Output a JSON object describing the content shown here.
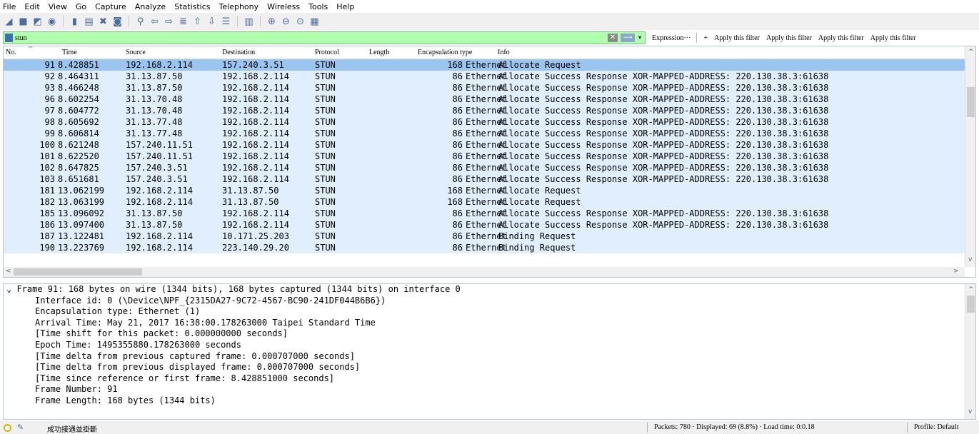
{
  "menu": [
    "File",
    "Edit",
    "View",
    "Go",
    "Capture",
    "Analyze",
    "Statistics",
    "Telephony",
    "Wireless",
    "Tools",
    "Help"
  ],
  "toolbar": {
    "icons": [
      "shark-fin-icon",
      "stop-icon",
      "restart-icon",
      "options-icon",
      "open-file-icon",
      "save-icon",
      "close-file-icon",
      "reload-icon",
      "find-icon",
      "back-icon",
      "forward-icon",
      "go-to-icon",
      "first-packet-icon",
      "last-packet-icon",
      "autoscroll-icon",
      "colorize-icon",
      "zoom-in-icon",
      "zoom-out-icon",
      "zoom-normal-icon",
      "resize-columns-icon"
    ]
  },
  "filter": {
    "value": "stun",
    "expression_label": "Expression···",
    "plus_label": "+",
    "apply_buttons": [
      "Apply this filter",
      "Apply this filter",
      "Apply this filter",
      "Apply this filter"
    ]
  },
  "columns": {
    "no": "No.",
    "time": "Time",
    "source": "Source",
    "destination": "Destination",
    "protocol": "Protocol",
    "length": "Length",
    "encapsulation": "Encapsulation type",
    "info": "Info"
  },
  "packets": [
    {
      "no": "91",
      "time": "8.428851",
      "src": "192.168.2.114",
      "dst": "157.240.3.51",
      "proto": "STUN",
      "len": "168",
      "enc": "Ethernet",
      "info": "Allocate Request"
    },
    {
      "no": "92",
      "time": "8.464311",
      "src": "31.13.87.50",
      "dst": "192.168.2.114",
      "proto": "STUN",
      "len": "86",
      "enc": "Ethernet",
      "info": "Allocate Success Response XOR-MAPPED-ADDRESS: 220.130.38.3:61638"
    },
    {
      "no": "93",
      "time": "8.466248",
      "src": "31.13.87.50",
      "dst": "192.168.2.114",
      "proto": "STUN",
      "len": "86",
      "enc": "Ethernet",
      "info": "Allocate Success Response XOR-MAPPED-ADDRESS: 220.130.38.3:61638"
    },
    {
      "no": "96",
      "time": "8.602254",
      "src": "31.13.70.48",
      "dst": "192.168.2.114",
      "proto": "STUN",
      "len": "86",
      "enc": "Ethernet",
      "info": "Allocate Success Response XOR-MAPPED-ADDRESS: 220.130.38.3:61638"
    },
    {
      "no": "97",
      "time": "8.604772",
      "src": "31.13.70.48",
      "dst": "192.168.2.114",
      "proto": "STUN",
      "len": "86",
      "enc": "Ethernet",
      "info": "Allocate Success Response XOR-MAPPED-ADDRESS: 220.130.38.3:61638"
    },
    {
      "no": "98",
      "time": "8.605692",
      "src": "31.13.77.48",
      "dst": "192.168.2.114",
      "proto": "STUN",
      "len": "86",
      "enc": "Ethernet",
      "info": "Allocate Success Response XOR-MAPPED-ADDRESS: 220.130.38.3:61638"
    },
    {
      "no": "99",
      "time": "8.606814",
      "src": "31.13.77.48",
      "dst": "192.168.2.114",
      "proto": "STUN",
      "len": "86",
      "enc": "Ethernet",
      "info": "Allocate Success Response XOR-MAPPED-ADDRESS: 220.130.38.3:61638"
    },
    {
      "no": "100",
      "time": "8.621248",
      "src": "157.240.11.51",
      "dst": "192.168.2.114",
      "proto": "STUN",
      "len": "86",
      "enc": "Ethernet",
      "info": "Allocate Success Response XOR-MAPPED-ADDRESS: 220.130.38.3:61638"
    },
    {
      "no": "101",
      "time": "8.622520",
      "src": "157.240.11.51",
      "dst": "192.168.2.114",
      "proto": "STUN",
      "len": "86",
      "enc": "Ethernet",
      "info": "Allocate Success Response XOR-MAPPED-ADDRESS: 220.130.38.3:61638"
    },
    {
      "no": "102",
      "time": "8.647825",
      "src": "157.240.3.51",
      "dst": "192.168.2.114",
      "proto": "STUN",
      "len": "86",
      "enc": "Ethernet",
      "info": "Allocate Success Response XOR-MAPPED-ADDRESS: 220.130.38.3:61638"
    },
    {
      "no": "103",
      "time": "8.651681",
      "src": "157.240.3.51",
      "dst": "192.168.2.114",
      "proto": "STUN",
      "len": "86",
      "enc": "Ethernet",
      "info": "Allocate Success Response XOR-MAPPED-ADDRESS: 220.130.38.3:61638"
    },
    {
      "no": "181",
      "time": "13.062199",
      "src": "192.168.2.114",
      "dst": "31.13.87.50",
      "proto": "STUN",
      "len": "168",
      "enc": "Ethernet",
      "info": "Allocate Request"
    },
    {
      "no": "182",
      "time": "13.063199",
      "src": "192.168.2.114",
      "dst": "31.13.87.50",
      "proto": "STUN",
      "len": "168",
      "enc": "Ethernet",
      "info": "Allocate Request"
    },
    {
      "no": "185",
      "time": "13.096092",
      "src": "31.13.87.50",
      "dst": "192.168.2.114",
      "proto": "STUN",
      "len": "86",
      "enc": "Ethernet",
      "info": "Allocate Success Response XOR-MAPPED-ADDRESS: 220.130.38.3:61638"
    },
    {
      "no": "186",
      "time": "13.097400",
      "src": "31.13.87.50",
      "dst": "192.168.2.114",
      "proto": "STUN",
      "len": "86",
      "enc": "Ethernet",
      "info": "Allocate Success Response XOR-MAPPED-ADDRESS: 220.130.38.3:61638"
    },
    {
      "no": "187",
      "time": "13.122481",
      "src": "192.168.2.114",
      "dst": "10.171.25.203",
      "proto": "STUN",
      "len": "86",
      "enc": "Ethernet",
      "info": "Binding Request"
    },
    {
      "no": "190",
      "time": "13.223769",
      "src": "192.168.2.114",
      "dst": "223.140.29.20",
      "proto": "STUN",
      "len": "86",
      "enc": "Ethernet",
      "info": "Binding Request"
    }
  ],
  "details": {
    "frame_line": "Frame 91: 168 bytes on wire (1344 bits), 168 bytes captured (1344 bits) on interface 0",
    "lines": [
      "Interface id: 0 (\\Device\\NPF_{2315DA27-9C72-4567-BC90-241DF044B6B6})",
      "Encapsulation type: Ethernet (1)",
      "Arrival Time: May 21, 2017 16:38:00.178263000 Taipei Standard Time",
      "[Time shift for this packet: 0.000000000 seconds]",
      "Epoch Time: 1495355880.178263000 seconds",
      "[Time delta from previous captured frame: 0.000707000 seconds]",
      "[Time delta from previous displayed frame: 0.000707000 seconds]",
      "[Time since reference or first frame: 8.428851000 seconds]",
      "Frame Number: 91",
      "Frame Length: 168 bytes (1344 bits)"
    ]
  },
  "status": {
    "message": "成功接通並掛斷",
    "stats": "Packets: 780 · Displayed: 69 (8.8%) · Load time: 0:0.18",
    "profile": "Profile: Default"
  },
  "colors": {
    "row_bg": "#e0eefd",
    "selected_bg": "#9ac5f0",
    "filter_bg": "#afffaf"
  }
}
